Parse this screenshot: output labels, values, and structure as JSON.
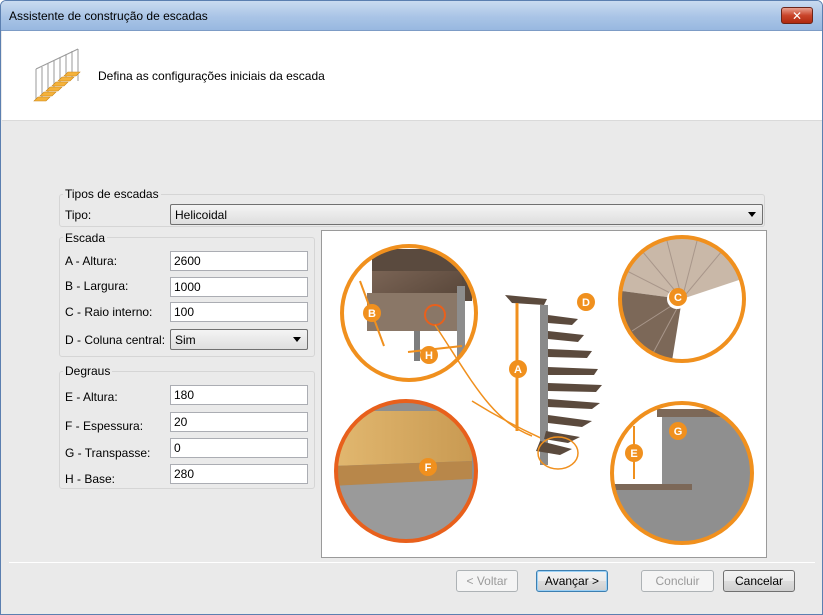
{
  "window": {
    "title": "Assistente de construção de escadas"
  },
  "header": {
    "description": "Defina as configurações iniciais da escada"
  },
  "tipos": {
    "group_label": "Tipos de escadas",
    "tipo_label": "Tipo:",
    "tipo_value": "Helicoidal"
  },
  "escada": {
    "group_label": "Escada",
    "fields": [
      {
        "label": "A - Altura:",
        "value": "2600"
      },
      {
        "label": "B - Largura:",
        "value": "1000"
      },
      {
        "label": "C - Raio interno:",
        "value": "100"
      }
    ],
    "coluna_label": "D - Coluna central:",
    "coluna_value": "Sim"
  },
  "degraus": {
    "group_label": "Degraus",
    "fields": [
      {
        "label": "E - Altura:",
        "value": "180"
      },
      {
        "label": "F - Espessura:",
        "value": "20"
      },
      {
        "label": "G - Transpasse:",
        "value": "0"
      },
      {
        "label": "H - Base:",
        "value": "280"
      }
    ]
  },
  "diagram_labels": {
    "a": "A",
    "b": "B",
    "c": "C",
    "d": "D",
    "e": "E",
    "f": "F",
    "g": "G",
    "h": "H"
  },
  "buttons": {
    "back": "< Voltar",
    "next": "Avançar >",
    "finish": "Concluir",
    "cancel": "Cancelar"
  },
  "colors": {
    "accent_orange": "#f0901e",
    "title_bar": "#a9c4e6"
  }
}
